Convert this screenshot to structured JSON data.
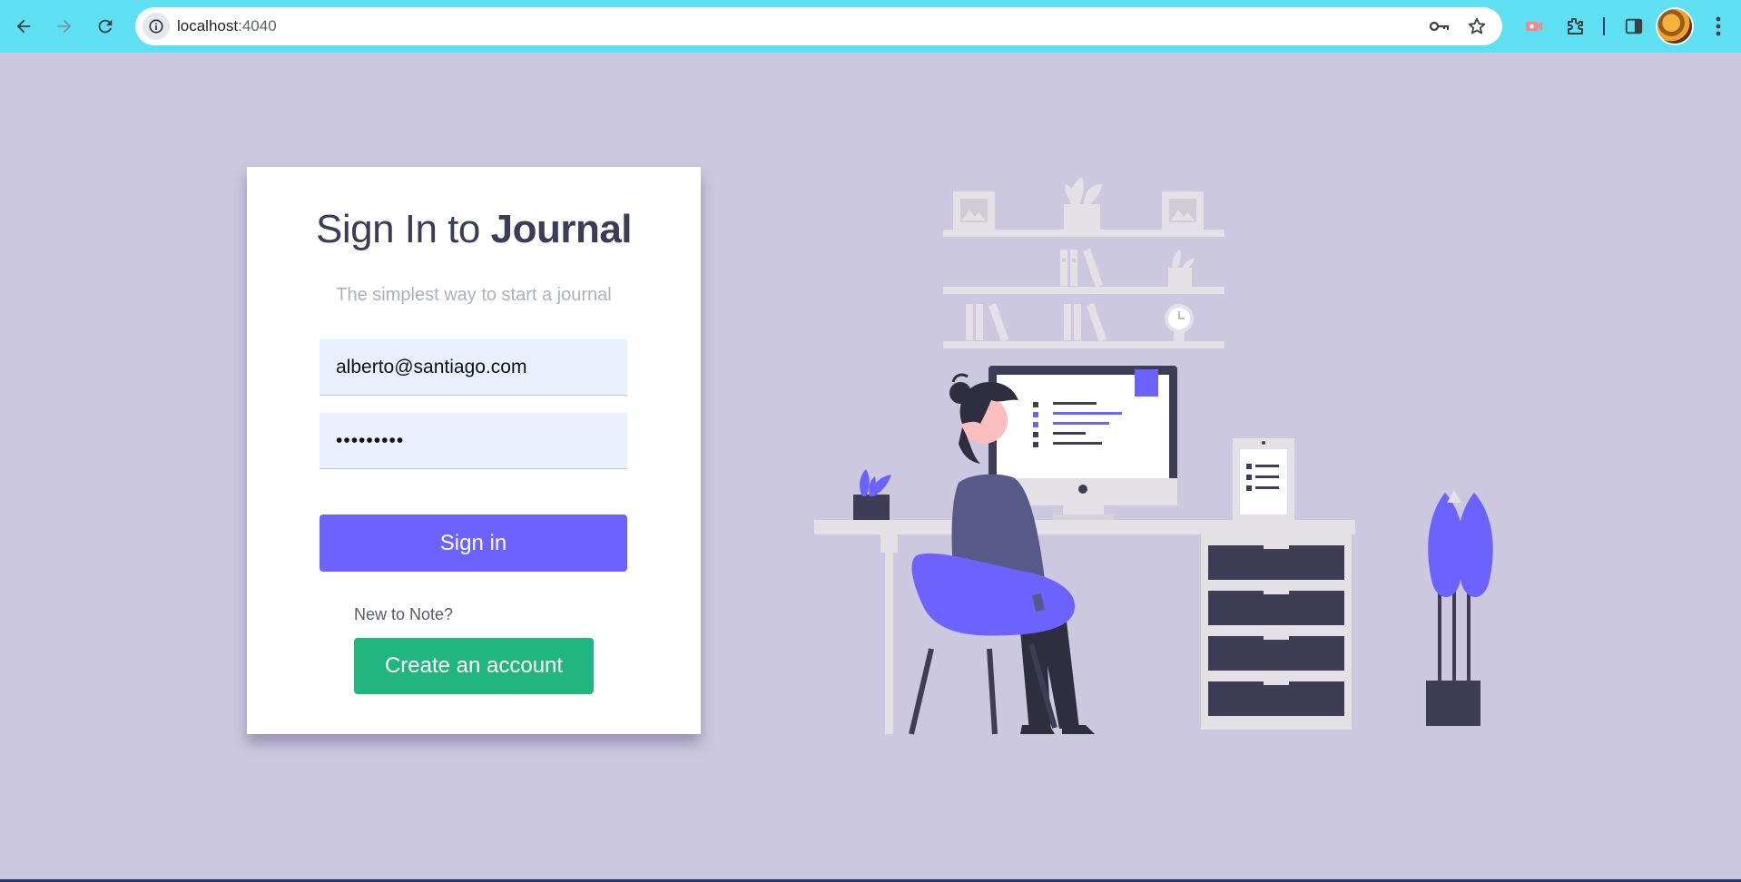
{
  "browser": {
    "url_host": "localhost",
    "url_port": ":4040",
    "icons": {
      "back": "arrow-left-icon",
      "forward": "arrow-right-icon",
      "reload": "reload-icon",
      "site_info": "info-icon",
      "password_key": "key-icon",
      "bookmark": "star-icon",
      "record": "camera-record-icon",
      "extensions": "puzzle-icon",
      "side_panel": "side-panel-icon",
      "menu": "kebab-menu-icon"
    }
  },
  "login": {
    "title_prefix": "Sign In to ",
    "title_brand": "Journal",
    "subtitle": "The simplest way to start a journal",
    "email_value": "alberto@santiago.com",
    "password_value": "*********",
    "signin_label": "Sign in",
    "new_prompt": "New to Note?",
    "create_label": "Create an account"
  },
  "colors": {
    "page_bg": "#ccc8e0",
    "chrome_bg": "#5ee0f2",
    "primary": "#6c63ff",
    "success": "#21b57f",
    "title": "#3b3c58"
  }
}
